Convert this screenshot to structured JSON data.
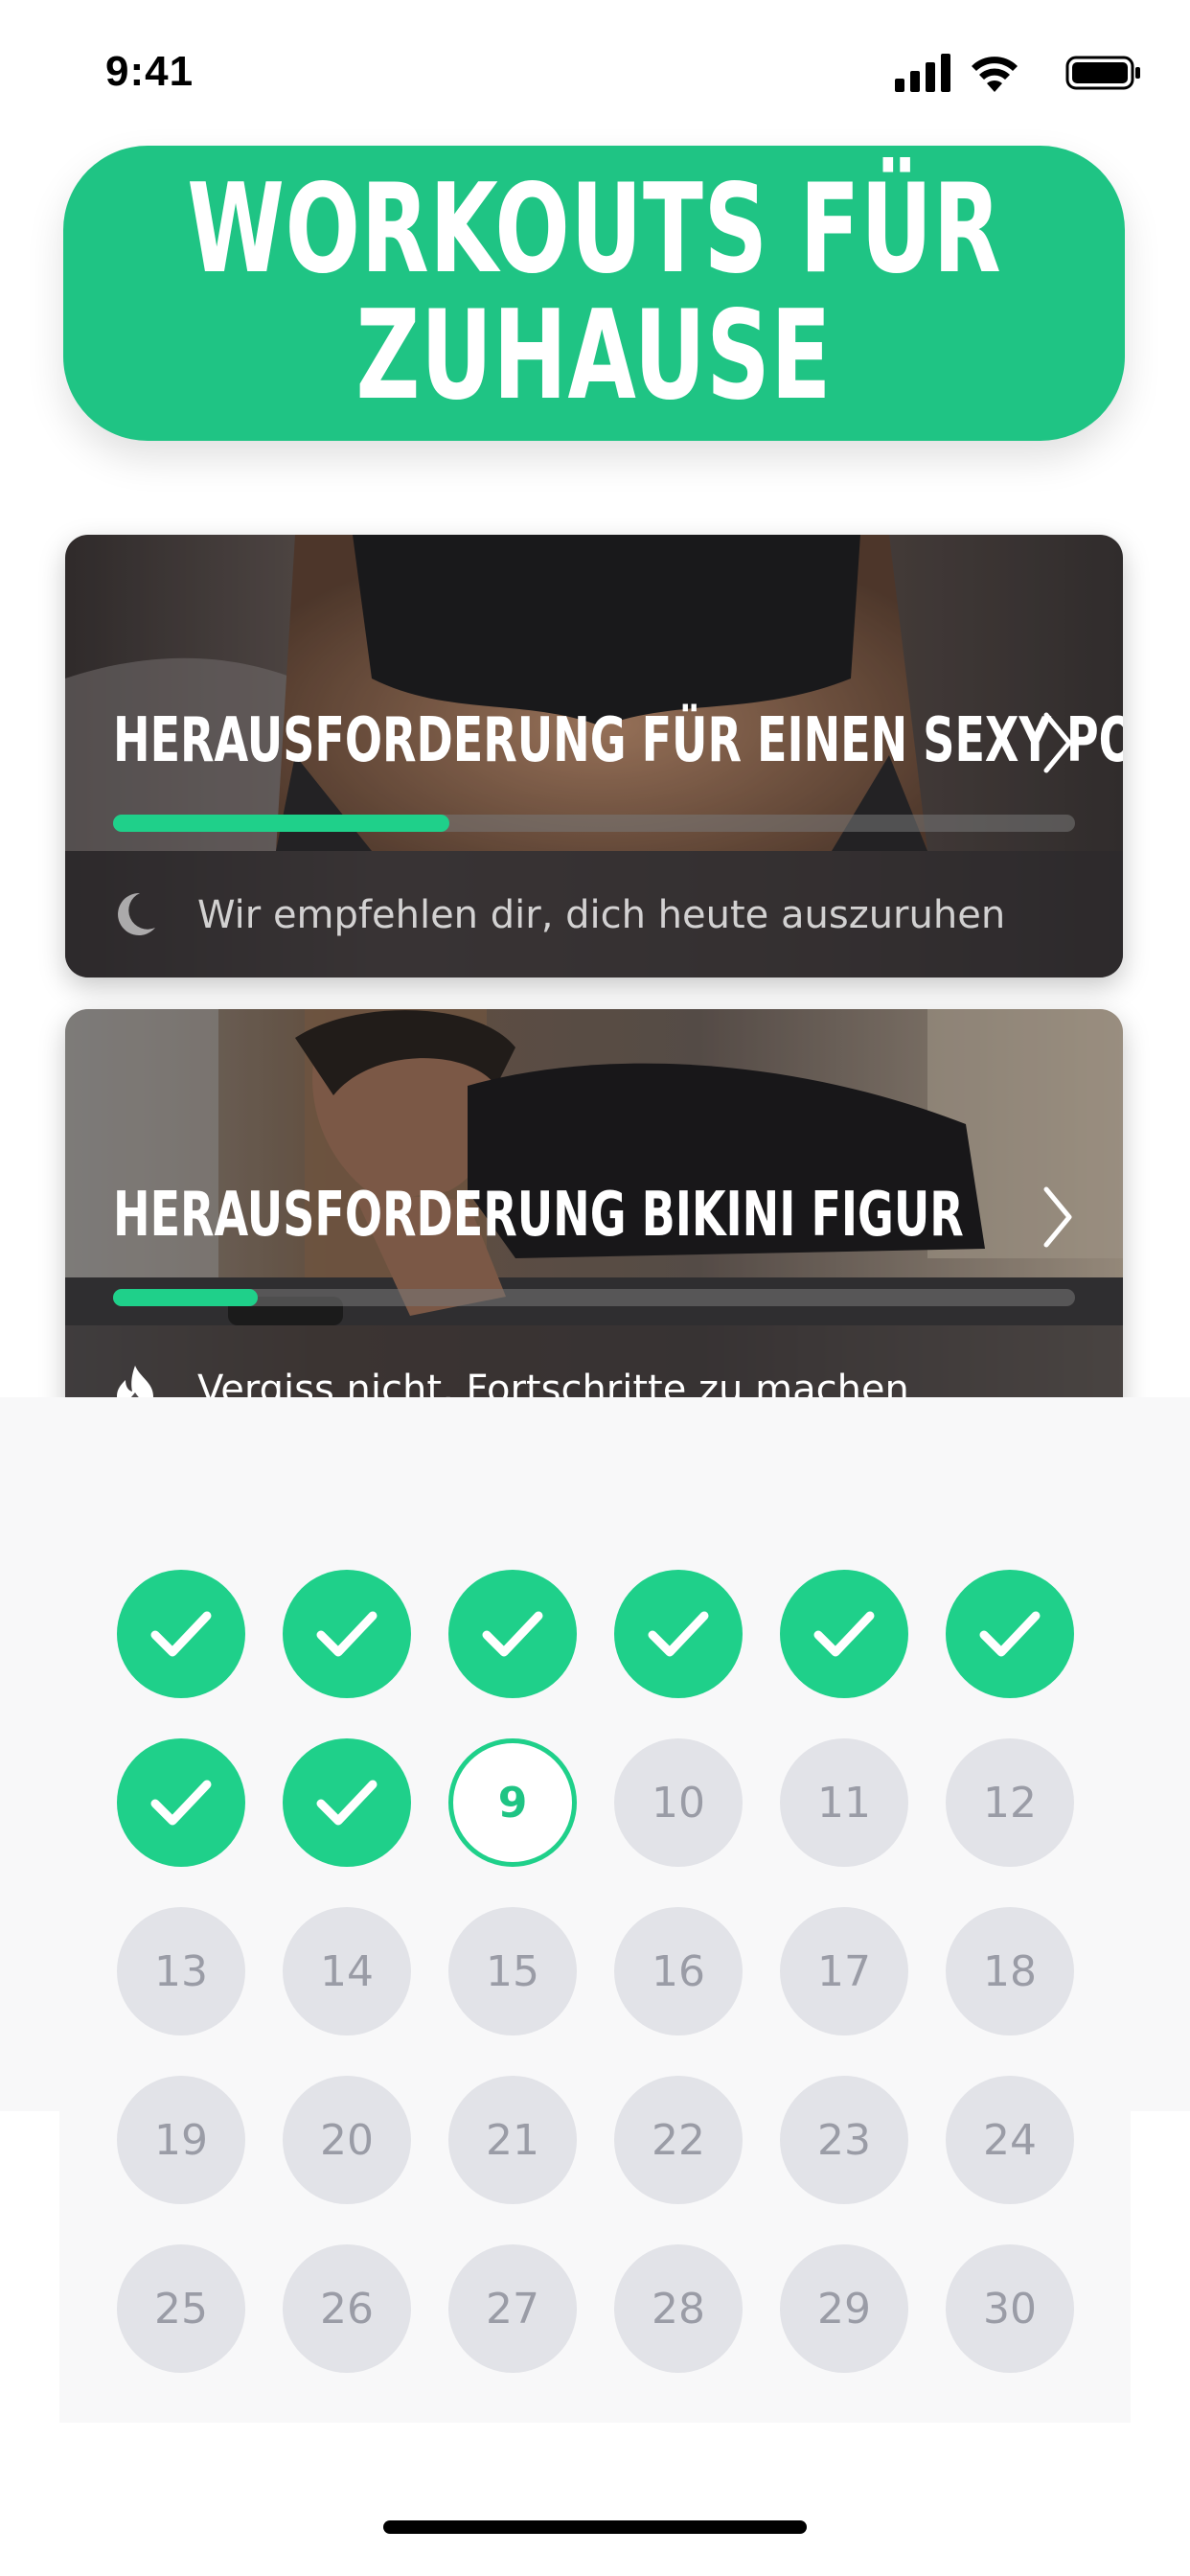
{
  "status_bar": {
    "time": "9:41"
  },
  "header": {
    "title_line1": "WORKOUTS FÜR",
    "title_line2": "ZUHAUSE"
  },
  "challenges": [
    {
      "title": "HERAUSFORDERUNG FÜR EINEN SEXY PO",
      "progress": 0.35,
      "footer_icon": "moon-icon",
      "footer_text": "Wir empfehlen dir, dich heute auszuruhen"
    },
    {
      "title": "HERAUSFORDERUNG BIKINI FIGUR",
      "progress": 0.15,
      "footer_icon": "flame-icon",
      "footer_text": "Vergiss nicht, Fortschritte zu machen"
    }
  ],
  "calendar": {
    "completed_days": [
      1,
      2,
      3,
      4,
      5,
      6,
      7,
      8
    ],
    "current_day": "9",
    "upcoming_days": [
      "10",
      "11",
      "12",
      "13",
      "14",
      "15",
      "16",
      "17",
      "18",
      "19",
      "20",
      "21",
      "22",
      "23",
      "24",
      "25",
      "26",
      "27",
      "28",
      "29",
      "30"
    ]
  },
  "colors": {
    "accent": "#1fc484",
    "day_done": "#1fd08a",
    "day_future": "#e2e3e8",
    "day_future_text": "#9a9ca6"
  }
}
